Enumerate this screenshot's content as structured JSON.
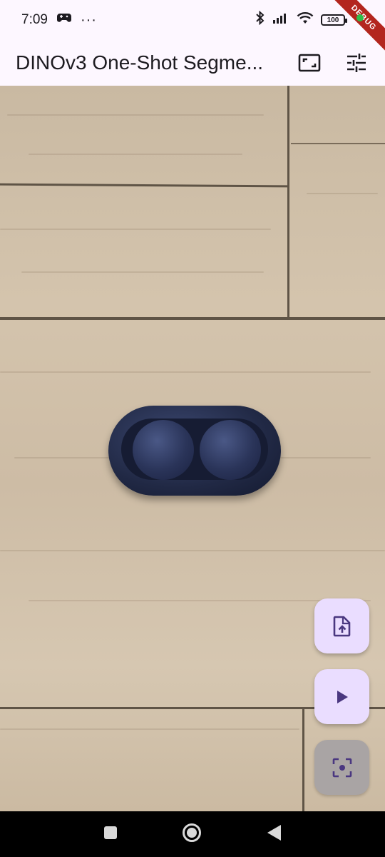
{
  "status_bar": {
    "time": "7:09",
    "more_indicator": "···",
    "battery_level": "100",
    "icons": [
      "gamepad-icon",
      "bluetooth-icon",
      "signal-icon",
      "wifi-icon",
      "battery-icon"
    ]
  },
  "debug_banner": "DEBUG",
  "app_bar": {
    "title": "DINOv3 One-Shot Segme...",
    "actions": [
      "aspect-ratio-icon",
      "tune-icon"
    ]
  },
  "fabs": {
    "upload": "upload-file-icon",
    "play": "play-icon",
    "focus": "center-focus-icon"
  },
  "nav": [
    "square-icon",
    "circle-icon",
    "back-triangle-icon"
  ],
  "colors": {
    "surface": "#fdf7ff",
    "fab_container": "#eaddff",
    "fab_icon": "#4a3780",
    "debug_ribbon": "#b3261e"
  }
}
